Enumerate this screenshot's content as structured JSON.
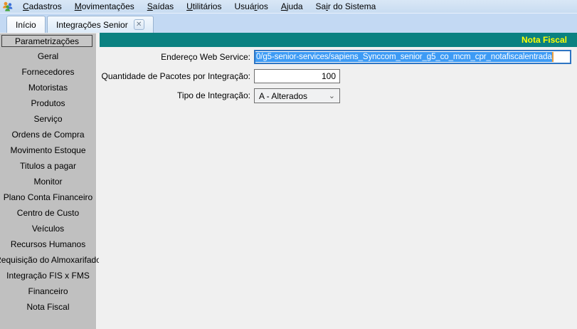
{
  "menu": {
    "items": [
      {
        "pre": "",
        "mn": "C",
        "post": "adastros"
      },
      {
        "pre": "",
        "mn": "M",
        "post": "ovimentações"
      },
      {
        "pre": "",
        "mn": "S",
        "post": "aídas"
      },
      {
        "pre": "",
        "mn": "U",
        "post": "tilitários"
      },
      {
        "pre": "Usuá",
        "mn": "r",
        "post": "ios"
      },
      {
        "pre": "",
        "mn": "A",
        "post": "juda"
      },
      {
        "pre": "Sa",
        "mn": "i",
        "post": "r do Sistema"
      }
    ]
  },
  "tabs": {
    "home": {
      "label": "Início"
    },
    "integrations": {
      "label": "Integrações Senior",
      "close_glyph": "✕"
    }
  },
  "sidebar": {
    "header": "Parametrizações",
    "items": [
      "Geral",
      "Fornecedores",
      "Motoristas",
      "Produtos",
      "Serviço",
      "Ordens de Compra",
      "Movimento Estoque",
      "Titulos a pagar",
      "Monitor",
      "Plano Conta Financeiro",
      "Centro de Custo",
      "Veículos",
      "Recursos Humanos",
      "Requisição do Almoxarifado",
      "Integração FIS x FMS",
      "Financeiro",
      "Nota Fiscal"
    ]
  },
  "panel": {
    "title": "Nota Fiscal",
    "fields": {
      "webservice": {
        "label": "Endereço Web Service:",
        "value": "0/g5-senior-services/sapiens_Synccom_senior_g5_co_mcm_cpr_notafiscalentrada",
        "state": "text-selected"
      },
      "packet_qty": {
        "label": "Quantidade de Pacotes por Integração:",
        "value": "100"
      },
      "integration_type": {
        "label": "Tipo de Integração:",
        "value": "A - Alterados",
        "arrow_glyph": "⌄"
      }
    }
  },
  "colors": {
    "panel_header_bg": "#0a8181",
    "panel_title_text": "#ffff00",
    "selection_bg": "#3d9bf5",
    "menubar_bg": "#cfe0f2",
    "tabstrip_bg": "#c3d9f3",
    "sidebar_bg": "#c0c0c0",
    "content_bg": "#f0f0f0",
    "focus_border": "#2e75c3"
  }
}
